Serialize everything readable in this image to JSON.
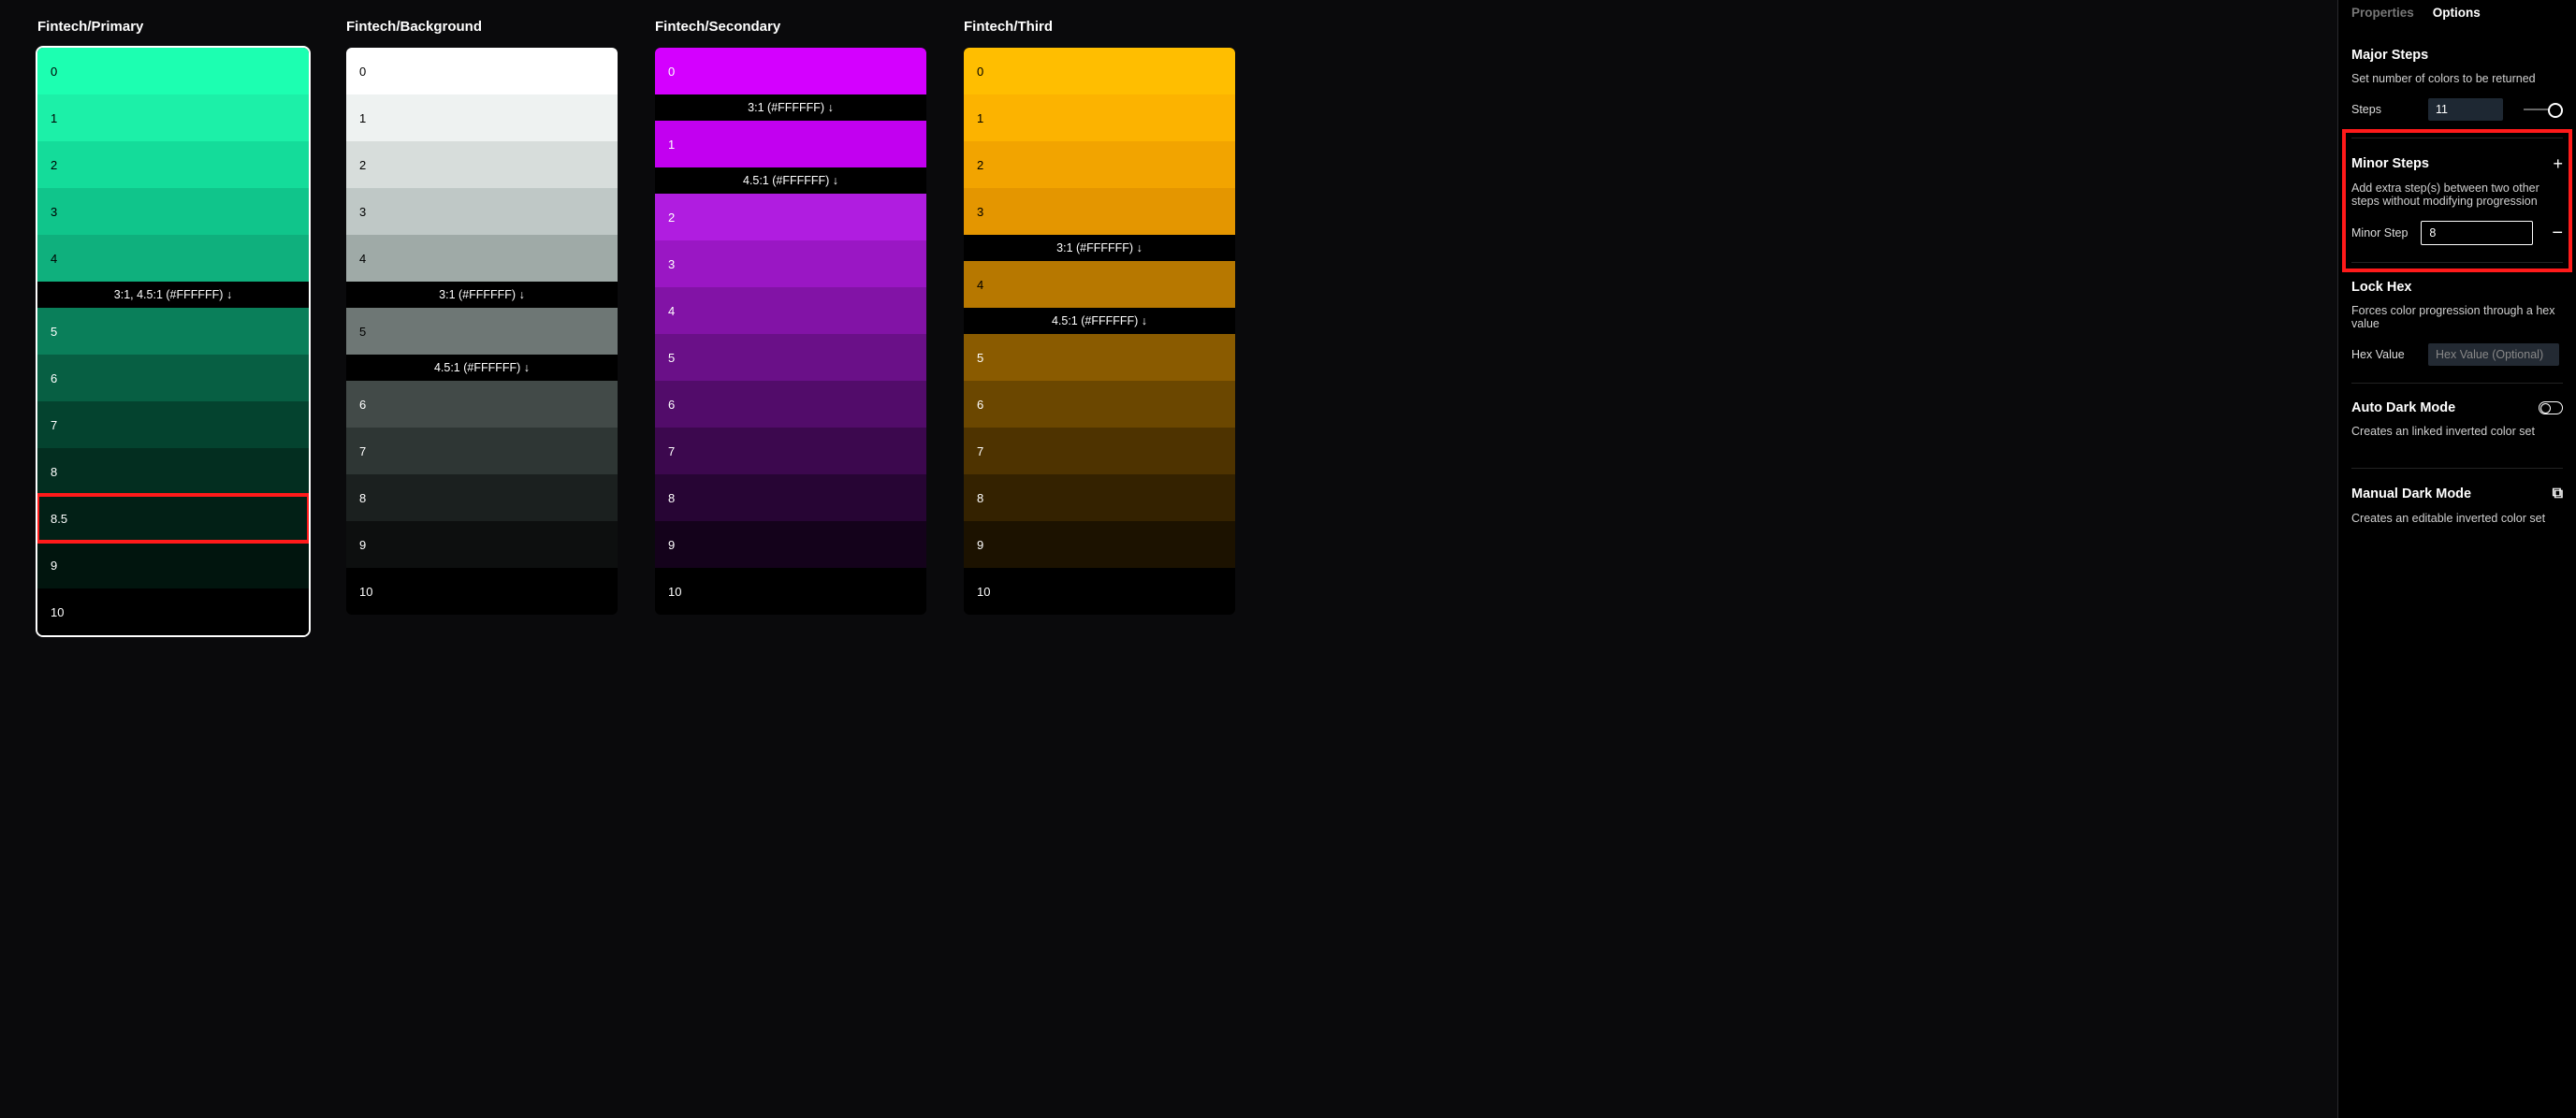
{
  "palettes": [
    {
      "title": "Fintech/Primary",
      "selected": true,
      "items": [
        {
          "type": "swatch",
          "label": "0",
          "bg": "#1cffb1",
          "fg": "#000"
        },
        {
          "type": "swatch",
          "label": "1",
          "bg": "#1cf0a8",
          "fg": "#000"
        },
        {
          "type": "swatch",
          "label": "2",
          "bg": "#14dc9a",
          "fg": "#000"
        },
        {
          "type": "swatch",
          "label": "3",
          "bg": "#10c58b",
          "fg": "#000"
        },
        {
          "type": "swatch",
          "label": "4",
          "bg": "#0fb07d",
          "fg": "#000"
        },
        {
          "type": "divider",
          "text": "3:1, 4.5:1 (#FFFFFF) ↓"
        },
        {
          "type": "swatch",
          "label": "5",
          "bg": "#0a7f5a",
          "fg": "#fff"
        },
        {
          "type": "swatch",
          "label": "6",
          "bg": "#075f43",
          "fg": "#fff"
        },
        {
          "type": "swatch",
          "label": "7",
          "bg": "#04432f",
          "fg": "#fff"
        },
        {
          "type": "swatch",
          "label": "8",
          "bg": "#032e20",
          "fg": "#fff"
        },
        {
          "type": "swatch",
          "label": "8.5",
          "bg": "#022016",
          "fg": "#fff",
          "highlighted": true
        },
        {
          "type": "swatch",
          "label": "9",
          "bg": "#01150e",
          "fg": "#fff"
        },
        {
          "type": "swatch",
          "label": "10",
          "bg": "#000000",
          "fg": "#fff"
        }
      ]
    },
    {
      "title": "Fintech/Background",
      "items": [
        {
          "type": "swatch",
          "label": "0",
          "bg": "#ffffff",
          "fg": "#000"
        },
        {
          "type": "swatch",
          "label": "1",
          "bg": "#eef2f1",
          "fg": "#000"
        },
        {
          "type": "swatch",
          "label": "2",
          "bg": "#d7dddb",
          "fg": "#000"
        },
        {
          "type": "swatch",
          "label": "3",
          "bg": "#bfc8c6",
          "fg": "#000"
        },
        {
          "type": "swatch",
          "label": "4",
          "bg": "#9faaa7",
          "fg": "#000"
        },
        {
          "type": "divider",
          "text": "3:1 (#FFFFFF) ↓"
        },
        {
          "type": "swatch",
          "label": "5",
          "bg": "#6e7775",
          "fg": "#000"
        },
        {
          "type": "divider",
          "text": "4.5:1 (#FFFFFF) ↓"
        },
        {
          "type": "swatch",
          "label": "6",
          "bg": "#424a48",
          "fg": "#fff"
        },
        {
          "type": "swatch",
          "label": "7",
          "bg": "#2e3634",
          "fg": "#fff"
        },
        {
          "type": "swatch",
          "label": "8",
          "bg": "#1b201f",
          "fg": "#fff"
        },
        {
          "type": "swatch",
          "label": "9",
          "bg": "#0d0f0f",
          "fg": "#fff"
        },
        {
          "type": "swatch",
          "label": "10",
          "bg": "#000000",
          "fg": "#fff"
        }
      ]
    },
    {
      "title": "Fintech/Secondary",
      "items": [
        {
          "type": "swatch",
          "label": "0",
          "bg": "#d400ff",
          "fg": "#fff"
        },
        {
          "type": "divider",
          "text": "3:1 (#FFFFFF) ↓"
        },
        {
          "type": "swatch",
          "label": "1",
          "bg": "#c200f0",
          "fg": "#fff"
        },
        {
          "type": "divider",
          "text": "4.5:1 (#FFFFFF) ↓"
        },
        {
          "type": "swatch",
          "label": "2",
          "bg": "#b01de0",
          "fg": "#fff"
        },
        {
          "type": "swatch",
          "label": "3",
          "bg": "#9a17c4",
          "fg": "#fff"
        },
        {
          "type": "swatch",
          "label": "4",
          "bg": "#8213a6",
          "fg": "#fff"
        },
        {
          "type": "swatch",
          "label": "5",
          "bg": "#6a1088",
          "fg": "#fff"
        },
        {
          "type": "swatch",
          "label": "6",
          "bg": "#520c6a",
          "fg": "#fff"
        },
        {
          "type": "swatch",
          "label": "7",
          "bg": "#3c084e",
          "fg": "#fff"
        },
        {
          "type": "swatch",
          "label": "8",
          "bg": "#270534",
          "fg": "#fff"
        },
        {
          "type": "swatch",
          "label": "9",
          "bg": "#14021b",
          "fg": "#fff"
        },
        {
          "type": "swatch",
          "label": "10",
          "bg": "#000000",
          "fg": "#fff"
        }
      ]
    },
    {
      "title": "Fintech/Third",
      "items": [
        {
          "type": "swatch",
          "label": "0",
          "bg": "#ffbe00",
          "fg": "#000"
        },
        {
          "type": "swatch",
          "label": "1",
          "bg": "#fcb300",
          "fg": "#000"
        },
        {
          "type": "swatch",
          "label": "2",
          "bg": "#f2a400",
          "fg": "#000"
        },
        {
          "type": "swatch",
          "label": "3",
          "bg": "#e49600",
          "fg": "#000"
        },
        {
          "type": "divider",
          "text": "3:1 (#FFFFFF) ↓"
        },
        {
          "type": "swatch",
          "label": "4",
          "bg": "#b77800",
          "fg": "#000"
        },
        {
          "type": "divider",
          "text": "4.5:1 (#FFFFFF) ↓"
        },
        {
          "type": "swatch",
          "label": "5",
          "bg": "#8a5b00",
          "fg": "#fff"
        },
        {
          "type": "swatch",
          "label": "6",
          "bg": "#6b4700",
          "fg": "#fff"
        },
        {
          "type": "swatch",
          "label": "7",
          "bg": "#4e3300",
          "fg": "#fff"
        },
        {
          "type": "swatch",
          "label": "8",
          "bg": "#342200",
          "fg": "#fff"
        },
        {
          "type": "swatch",
          "label": "9",
          "bg": "#1c1200",
          "fg": "#fff"
        },
        {
          "type": "swatch",
          "label": "10",
          "bg": "#000000",
          "fg": "#fff"
        }
      ]
    }
  ],
  "panel": {
    "tabs": {
      "properties": "Properties",
      "options": "Options",
      "active": "options"
    },
    "major": {
      "title": "Major Steps",
      "desc": "Set number of colors to be returned",
      "field_label": "Steps",
      "value": "11"
    },
    "minor": {
      "title": "Minor Steps",
      "desc": "Add extra step(s) between two other steps without modifying progression",
      "field_label": "Minor Step",
      "value": "8",
      "highlighted": true
    },
    "lock": {
      "title": "Lock Hex",
      "desc": "Forces color progression through a hex value",
      "field_label": "Hex Value",
      "placeholder": "Hex Value (Optional)"
    },
    "autodark": {
      "title": "Auto Dark Mode",
      "desc": "Creates an linked inverted color set"
    },
    "manualdark": {
      "title": "Manual Dark Mode",
      "desc": "Creates an editable inverted color set"
    }
  }
}
